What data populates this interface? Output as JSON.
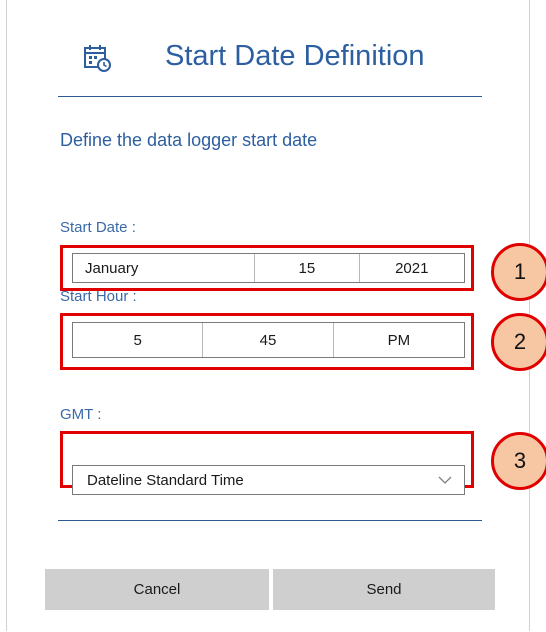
{
  "header": {
    "icon": "calendar-clock-icon",
    "title": "Start Date Definition",
    "subtitle": "Define the data logger start date",
    "accent": "#2d5fa0"
  },
  "start_date": {
    "label": "Start Date :",
    "month": "January",
    "day": "15",
    "year": "2021"
  },
  "start_hour": {
    "label": "Start Hour :",
    "hour": "5",
    "minute": "45",
    "period": "PM"
  },
  "gmt": {
    "label": "GMT :",
    "selected": "Dateline Standard Time",
    "icon": "chevron-down-icon"
  },
  "callouts": [
    "1",
    "2",
    "3"
  ],
  "callout_colors": {
    "border": "#e00000",
    "fill": "#f7c7a4"
  },
  "buttons": {
    "cancel": "Cancel",
    "send": "Send"
  }
}
